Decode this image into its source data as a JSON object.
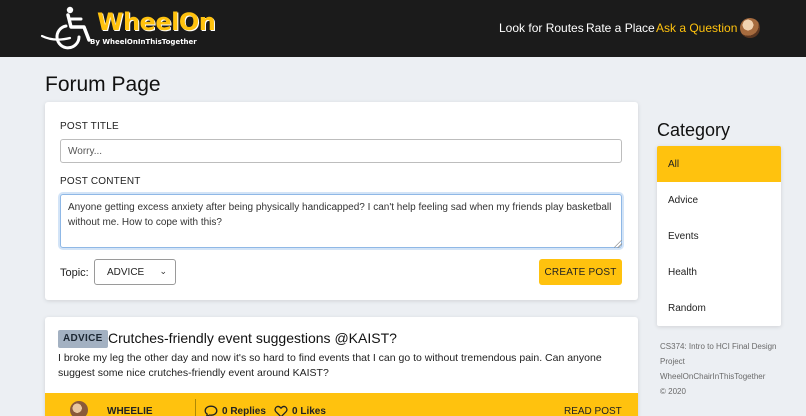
{
  "app": {
    "logo_name": "WheelOn",
    "logo_sub": "By WheelOnInThisTogether",
    "brand_color": "#ffc20e",
    "nav": [
      {
        "label": "Look for Routes",
        "active": false
      },
      {
        "label": "Rate a Place",
        "active": false
      },
      {
        "label": "Ask a Question",
        "active": true
      }
    ]
  },
  "page": {
    "title": "Forum Page"
  },
  "form": {
    "title_label": "POST TITLE",
    "title_placeholder": "Worry...",
    "content_label": "POST CONTENT",
    "content_value": "Anyone getting excess anxiety after being physically handicapped? I can't help feeling sad when my friends play basketball without me. How to cope with this?",
    "topic_label": "Topic:",
    "topic_selected": "ADVICE",
    "create_button": "CREATE POST"
  },
  "posts": [
    {
      "badge": "ADVICE",
      "title": "Crutches-friendly event suggestions @KAIST?",
      "body": "I broke my leg the other day and now it's so hard to find events that I can go to without tremendous pain. Can anyone suggest some nice crutches-friendly event around KAIST?",
      "author": "WHEELIE",
      "replies": "0 Replies",
      "likes": "0 Likes",
      "read_label": "READ POST"
    }
  ],
  "categories": {
    "heading": "Category",
    "items": [
      {
        "label": "All",
        "active": true
      },
      {
        "label": "Advice",
        "active": false
      },
      {
        "label": "Events",
        "active": false
      },
      {
        "label": "Health",
        "active": false
      },
      {
        "label": "Random",
        "active": false
      }
    ]
  },
  "footer_note": {
    "line1": "CS374: Intro to HCI Final Design Project",
    "line2": "WheelOnChairInThisTogether",
    "line3": "© 2020"
  }
}
